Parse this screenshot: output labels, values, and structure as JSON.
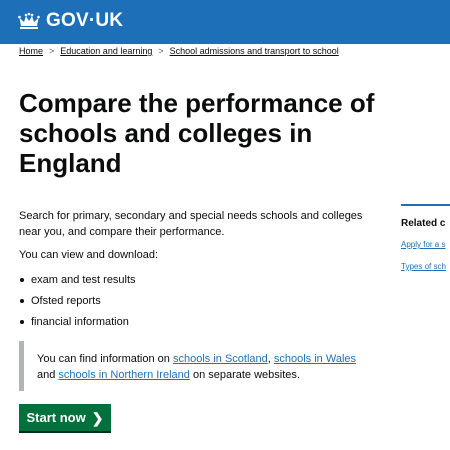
{
  "header": {
    "logo_text": "GOV·UK"
  },
  "breadcrumbs": [
    "Home",
    "Education and learning",
    "School admissions and transport to school"
  ],
  "page_title": "Compare the performance of schools and colleges in England",
  "intro": "Search for primary, secondary and special needs schools and colleges near you, and compare their performance.",
  "view_text": "You can view and download:",
  "bullets": [
    "exam and test results",
    "Ofsted reports",
    "financial information"
  ],
  "inset": {
    "prefix": "You can find information on ",
    "link_scotland": "schools in Scotland",
    "sep1": ", ",
    "link_wales": "schools in Wales",
    "sep2": " and ",
    "link_ni": "schools in Northern Ireland",
    "suffix": " on separate websites."
  },
  "start_button": {
    "label": "Start now",
    "arrow": "❯"
  },
  "related": {
    "title": "Related c",
    "links": [
      "Apply for a s",
      "Types of sch"
    ]
  },
  "colors": {
    "brand_blue": "#1d70b8",
    "start_green": "#00703c",
    "text": "#0b0c0c",
    "inset_border": "#b1b4b6"
  }
}
